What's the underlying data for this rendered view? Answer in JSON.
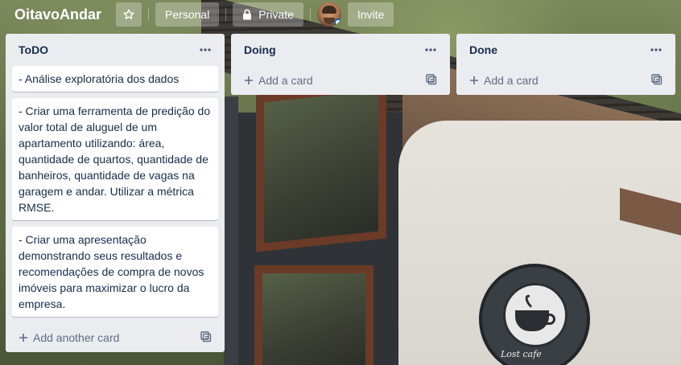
{
  "header": {
    "board_title": "OitavoAndar",
    "star_icon": "star-icon",
    "personal_label": "Personal",
    "private_label": "Private",
    "invite_label": "Invite"
  },
  "lists": [
    {
      "title": "ToDO",
      "cards": [
        "- Análise exploratória dos dados",
        "- Criar uma ferramenta de predição do valor total de aluguel de um apartamento utilizando: área, quantidade de quartos, quantidade de banheiros, quantidade de vagas na garagem e andar. Utilizar a métrica RMSE.",
        "- Criar uma apresentação demonstrando seus resultados e recomendações de compra de novos imóveis para maximizar o lucro da empresa."
      ],
      "add_label": "Add another card"
    },
    {
      "title": "Doing",
      "cards": [],
      "add_label": "Add a card"
    },
    {
      "title": "Done",
      "cards": [],
      "add_label": "Add a card"
    }
  ],
  "background": {
    "sign_text": "Lost cafe"
  },
  "colors": {
    "list_bg": "#ebecf0",
    "card_text": "#172b4d",
    "muted_text": "#5e6c84"
  }
}
